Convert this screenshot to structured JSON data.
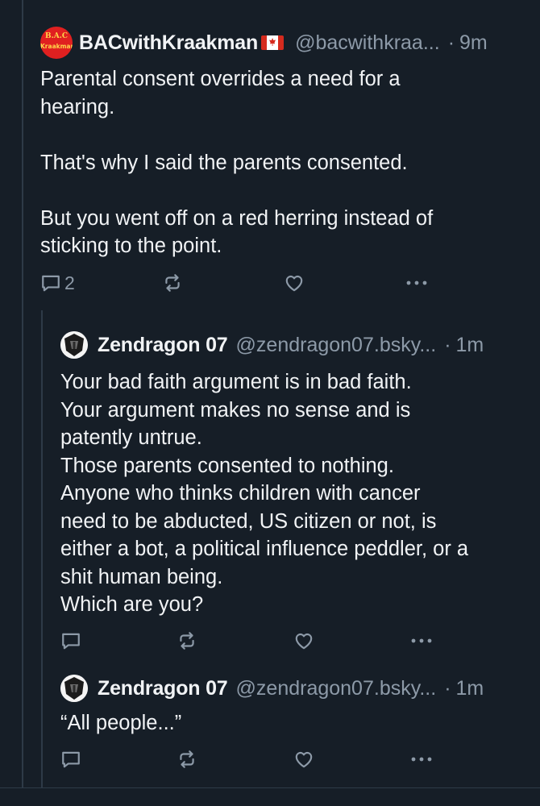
{
  "posts": [
    {
      "display_name": "BACwithKraakman",
      "handle": "@bacwithkraa...",
      "separator": "·",
      "time": "9m",
      "avatar_text_top": "B.A.C",
      "avatar_text_bottom": "Kraakman",
      "body": "Parental consent overrides a need for a\nhearing.\n\nThat's why I said the parents consented.\n\nBut you went off on a red herring instead of\nsticking to the point.",
      "reply_count": "2"
    },
    {
      "display_name": "Zendragon 07",
      "handle": "@zendragon07.bsky...",
      "separator": "·",
      "time": "1m",
      "body": "Your bad faith argument is in bad faith.\nYour argument makes no sense and is\npatently untrue.\nThose parents consented to nothing.\nAnyone who thinks children with cancer\nneed to be abducted, US citizen or not, is\neither a bot, a political influence peddler, or a\nshit human being.\nWhich are you?",
      "reply_count": ""
    },
    {
      "display_name": "Zendragon 07",
      "handle": "@zendragon07.bsky...",
      "separator": "·",
      "time": "1m",
      "body": "“All people...”",
      "reply_count": ""
    }
  ],
  "icons": {
    "reply": "reply-icon",
    "repost": "repost-icon",
    "like": "heart-icon",
    "more": "more-options-icon",
    "flag": "canada-flag-icon"
  },
  "colors": {
    "background": "#161e27",
    "text": "#f1f3f5",
    "muted": "#8d9aa8",
    "thread_line": "#2e3a47"
  }
}
